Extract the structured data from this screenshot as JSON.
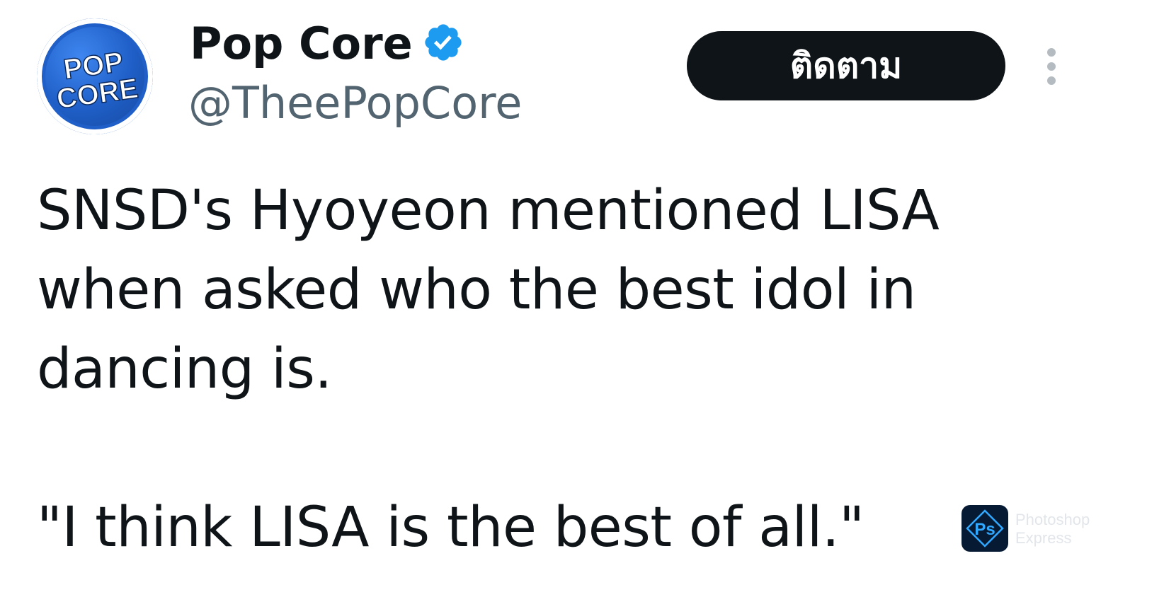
{
  "author": {
    "display_name": "Pop Core",
    "handle": "@TheePopCore",
    "verified": true,
    "verified_icon": "verified-badge-icon",
    "verified_color": "#1d9bf0",
    "avatar": {
      "line1": "POP",
      "line2": "CORE",
      "color": "#1f5fc7"
    }
  },
  "actions": {
    "follow_label": "ติดตาม",
    "more_icon": "more-vertical-icon"
  },
  "tweet": {
    "paragraph1": "SNSD's Hyoyeon mentioned LISA when asked who the best idol in dancing is.",
    "paragraph2": "\"I think LISA is the best of all.\""
  },
  "watermark": {
    "logo_text": "Ps",
    "line1": "Photoshop",
    "line2": "Express"
  },
  "colors": {
    "text_primary": "#0f1419",
    "text_secondary": "#536471",
    "button_bg": "#0f1419",
    "button_text": "#ffffff"
  }
}
